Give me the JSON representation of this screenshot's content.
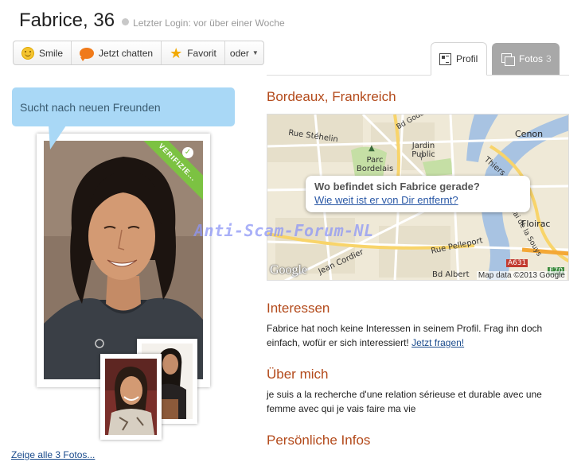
{
  "profile": {
    "name_age": "Fabrice, 36",
    "last_login": "Letzter Login: vor über einer Woche"
  },
  "actions": {
    "smile": "Smile",
    "chat": "Jetzt chatten",
    "favorite": "Favorit",
    "more": "oder"
  },
  "tabs": {
    "profil": "Profil",
    "fotos": "Fotos",
    "fotos_count": "3"
  },
  "status_bubble": "Sucht nach neuen Freunden",
  "verified_badge": "VERIFIZIE...",
  "show_all_photos": "Zeige alle 3 Fotos...",
  "location": {
    "title": "Bordeaux, Frankreich",
    "map_question": "Wo befindet sich Fabrice gerade?",
    "map_link": "Wie weit ist er von Dir entfernt?",
    "map_copyright": "Map data ©2013 Google",
    "map_google_logo": "Google",
    "map_labels": {
      "cenon": "Cenon",
      "jardin_public": "Jardin Public",
      "parc_bordelais": "Parc Bordelais",
      "floirac": "Floirac",
      "rue_stehelin": "Rue Stéhelin",
      "quai_souys": "Quai de la Souys",
      "rue_pelleport": "Rue Pelleport",
      "jean_cordier": "Jean Cordier",
      "bd_albert": "Bd Albert",
      "a631": "A631",
      "e70": "E70",
      "thiers": "Thiers",
      "bd_godard": "Bd Godard"
    }
  },
  "interessen": {
    "title": "Interessen",
    "text": "Fabrice hat noch keine Interessen in seinem Profil. Frag ihn doch einfach, wofür er sich interessiert!",
    "link": "Jetzt fragen!"
  },
  "ueber_mich": {
    "title": "Über mich",
    "text": "je suis a la recherche d'une relation sérieuse et durable avec une femme avec qui je vais faire ma vie"
  },
  "persoenliche_infos": {
    "title": "Persönliche Infos"
  },
  "watermark": "Anti-Scam-Forum-NL",
  "colors": {
    "accent": "#b34a1b",
    "bubble": "#a9d8f6",
    "verified": "#7cc242",
    "link": "#1a4b8c",
    "tab_inactive": "#a8a8a8"
  }
}
